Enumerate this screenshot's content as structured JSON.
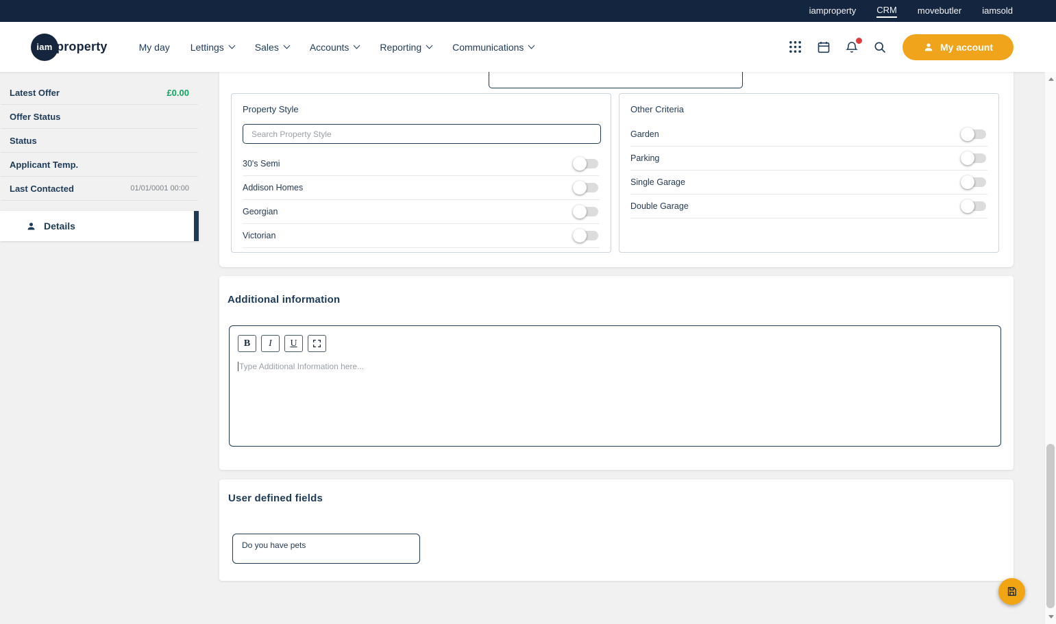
{
  "topbar": {
    "links": [
      {
        "label": "iamproperty",
        "active": false
      },
      {
        "label": "CRM",
        "active": true
      },
      {
        "label": "movebutler",
        "active": false
      },
      {
        "label": "iamsold",
        "active": false
      }
    ]
  },
  "header": {
    "logo": {
      "circle_text": "iam",
      "text": "property"
    },
    "nav": [
      {
        "label": "My day"
      },
      {
        "label": "Lettings"
      },
      {
        "label": "Sales"
      },
      {
        "label": "Accounts"
      },
      {
        "label": "Reporting"
      },
      {
        "label": "Communications"
      }
    ],
    "account_button": "My account"
  },
  "sidebar": {
    "fields": [
      {
        "label": "Latest Offer",
        "value": "£0.00"
      },
      {
        "label": "Offer Status",
        "value": ""
      },
      {
        "label": "Status",
        "value": ""
      },
      {
        "label": "Applicant Temp.",
        "value": ""
      },
      {
        "label": "Last Contacted",
        "value": "01/01/0001 00:00"
      }
    ],
    "details_item": "Details"
  },
  "main": {
    "property_style": {
      "title": "Property Style",
      "search_placeholder": "Search Property Style",
      "options": [
        {
          "label": "30's Semi",
          "enabled": false
        },
        {
          "label": "Addison Homes",
          "enabled": false
        },
        {
          "label": "Georgian",
          "enabled": false
        },
        {
          "label": "Victorian",
          "enabled": false
        }
      ]
    },
    "other_criteria": {
      "title": "Other Criteria",
      "options": [
        {
          "label": "Garden",
          "enabled": false
        },
        {
          "label": "Parking",
          "enabled": false
        },
        {
          "label": "Single Garage",
          "enabled": false
        },
        {
          "label": "Double Garage",
          "enabled": false
        }
      ]
    },
    "additional_information": {
      "title": "Additional information",
      "toolbar": [
        "B",
        "I",
        "U"
      ],
      "placeholder": "Type Additional Information here..."
    },
    "user_defined_fields": {
      "title": "User defined fields",
      "fields": [
        {
          "label": "Do you have pets"
        }
      ]
    }
  },
  "colors": {
    "accent_orange": "#F0A41C",
    "navy": "#1D3A57",
    "topbar_navy": "#13253F",
    "positive_green": "#12A463",
    "page_background": "#F1F1F1"
  }
}
